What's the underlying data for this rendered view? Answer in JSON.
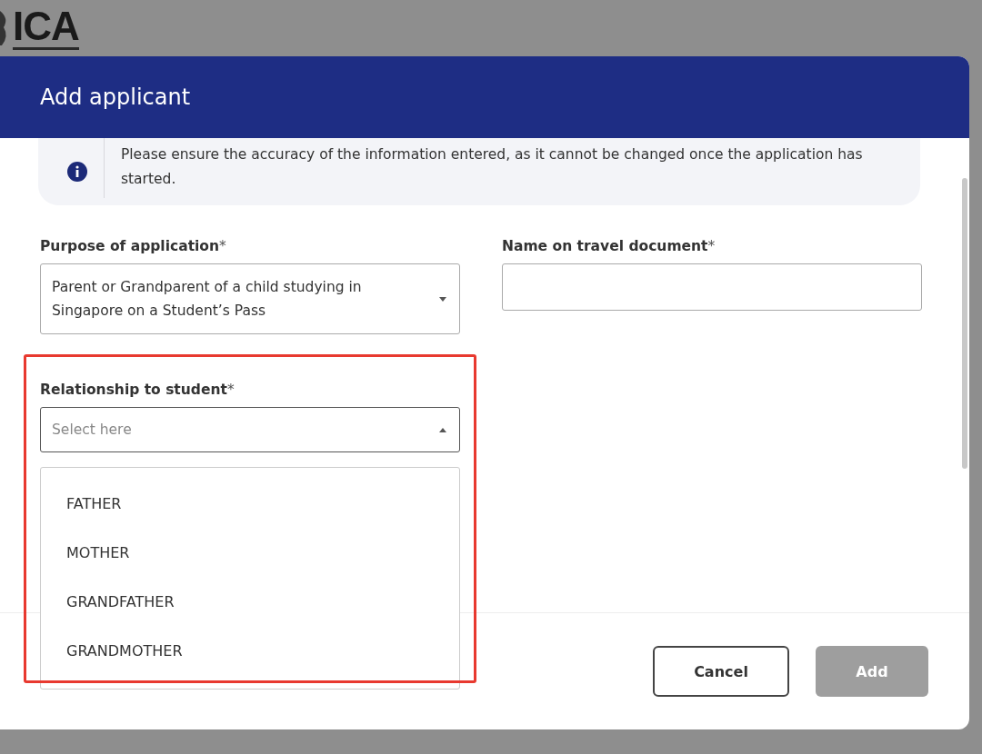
{
  "logo": "ICA",
  "dialog": {
    "title": "Add applicant"
  },
  "notice": "Please ensure the accuracy of the information entered, as it cannot be changed once the application has started.",
  "fields": [
    {
      "kind": "select",
      "label": "Purpose of application",
      "marker": "*",
      "value": "Parent or Grandparent of a child studying in Singapore on a Student’s Pass",
      "expanded": false
    },
    {
      "kind": "text",
      "label": "Name on travel document",
      "marker": "*"
    },
    {
      "kind": "select",
      "label": "Relationship to student",
      "marker": "*",
      "placeholder": "Select here",
      "expanded": true,
      "highlighted": true,
      "options": [
        "FATHER",
        "MOTHER",
        "GRANDFATHER",
        "GRANDMOTHER"
      ]
    }
  ],
  "buttons": [
    {
      "label": "Cancel",
      "disabled": false
    },
    {
      "label": "Add",
      "disabled": true
    }
  ]
}
